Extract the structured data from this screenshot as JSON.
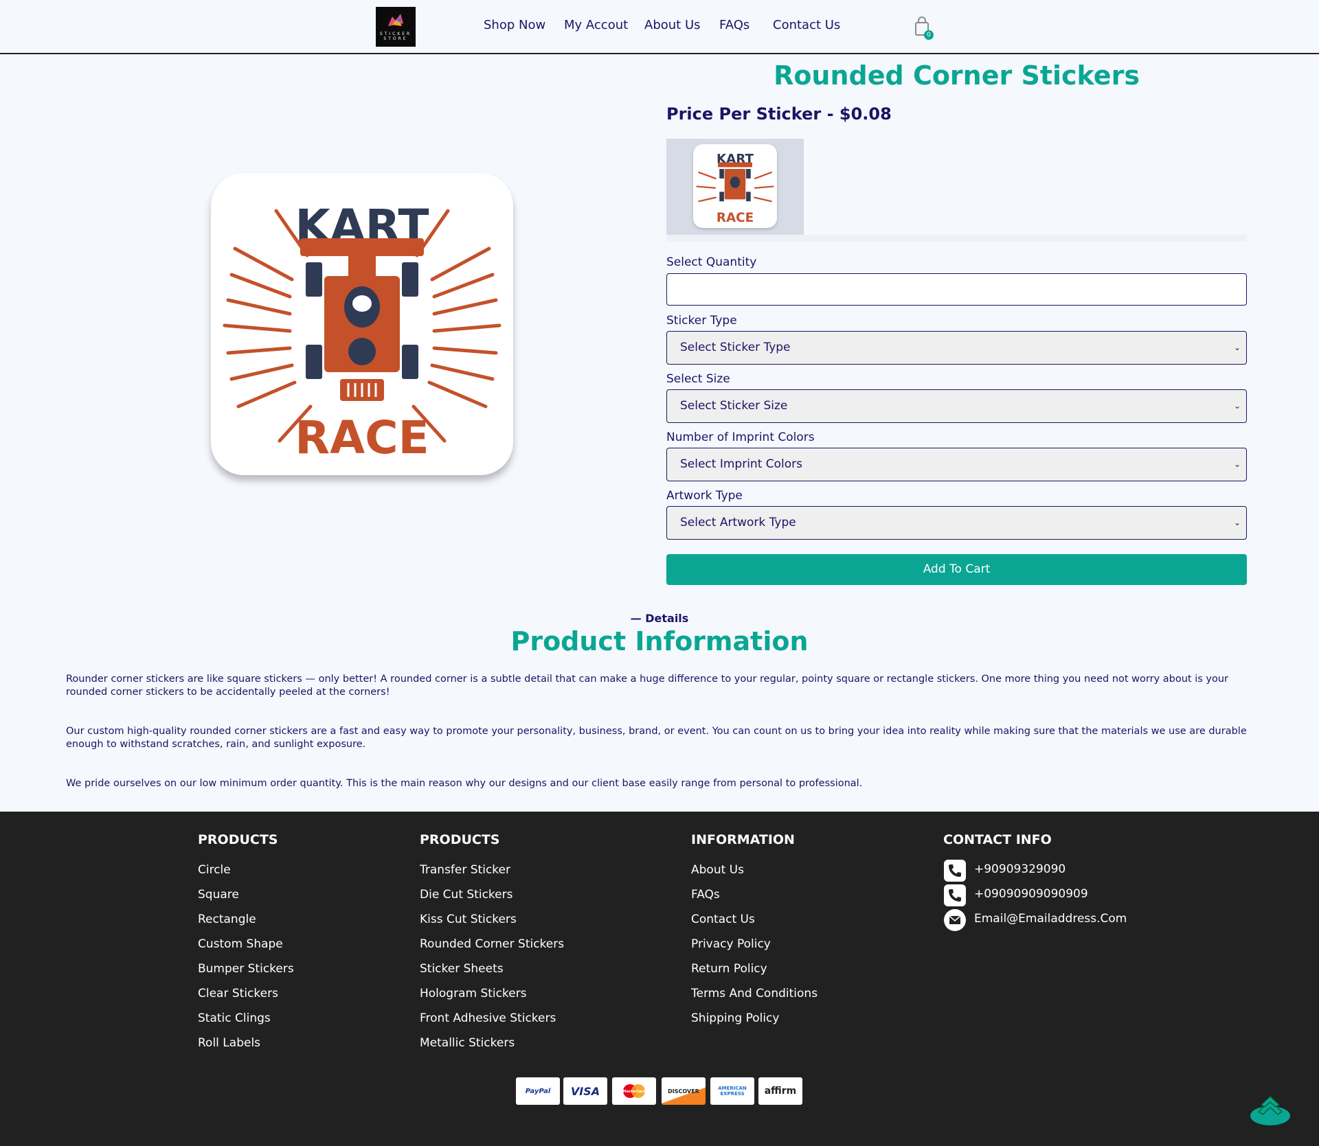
{
  "header": {
    "logo_text": "STICKER STORE",
    "nav": [
      "Shop Now",
      "My Accout",
      "About Us",
      "FAQs",
      "Contact Us"
    ],
    "cart_count": "0"
  },
  "product": {
    "title": "Rounded Corner Stickers",
    "price": "Price Per Sticker - $0.08",
    "image_text_top": "KART",
    "image_text_bottom": "RACE",
    "quantity_label": "Select Quantity",
    "quantity_value": "",
    "sticker_type_label": "Sticker Type",
    "sticker_type_value": "Select Sticker Type",
    "size_label": "Select Size",
    "size_value": "Select Sticker Size",
    "colors_label": "Number of Imprint Colors",
    "colors_value": "Select Imprint Colors",
    "artwork_label": "Artwork Type",
    "artwork_value": "Select Artwork Type",
    "add_to_cart": "Add To Cart"
  },
  "details": {
    "kicker": "— Details",
    "title": "Product Information",
    "paragraphs": [
      "Rounder corner stickers are like square stickers — only better! A rounded corner is a subtle detail that can make a huge difference to your regular, pointy square or rectangle stickers. One more thing you need not worry about is your rounded corner stickers to be accidentally peeled at the corners!",
      "Our custom high-quality rounded corner stickers are a fast and easy way to promote your personality, business, brand, or event. You can count on us to bring your idea into reality while making sure that the materials we use are durable enough to withstand scratches, rain, and sunlight exposure.",
      "We pride ourselves on our low minimum order quantity. This is the main reason why our designs and our client base easily range from personal to professional."
    ]
  },
  "footer": {
    "col1": {
      "heading": "PRODUCTS",
      "links": [
        "Circle",
        "Square",
        "Rectangle",
        "Custom Shape",
        "Bumper Stickers",
        "Clear Stickers",
        "Static Clings",
        "Roll Labels"
      ]
    },
    "col2": {
      "heading": "PRODUCTS",
      "links": [
        "Transfer Sticker",
        "Die Cut Stickers",
        "Kiss Cut Stickers",
        "Rounded Corner Stickers",
        "Sticker Sheets",
        "Hologram Stickers",
        "Front Adhesive Stickers",
        "Metallic Stickers"
      ]
    },
    "col3": {
      "heading": "INFORMATION",
      "links": [
        "About Us",
        "FAQs",
        "Contact Us",
        "Privacy Policy",
        "Return Policy",
        "Terms And Conditions",
        "Shipping Policy"
      ]
    },
    "contact": {
      "heading": "CONTACT INFO",
      "phone1": "+90909329090",
      "phone2": "+09090909090909",
      "email": "Email@Emailaddress.Com"
    },
    "payments": [
      "PayPal",
      "VISA",
      "MasterCard",
      "DISCOVER",
      "AMERICAN EXPRESS",
      "affirm"
    ]
  },
  "colors": {
    "accent": "#0aa693",
    "navy": "#1b1464",
    "footer": "#212121",
    "sticker_orange": "#c4512a",
    "sticker_navy": "#2f3b55"
  }
}
